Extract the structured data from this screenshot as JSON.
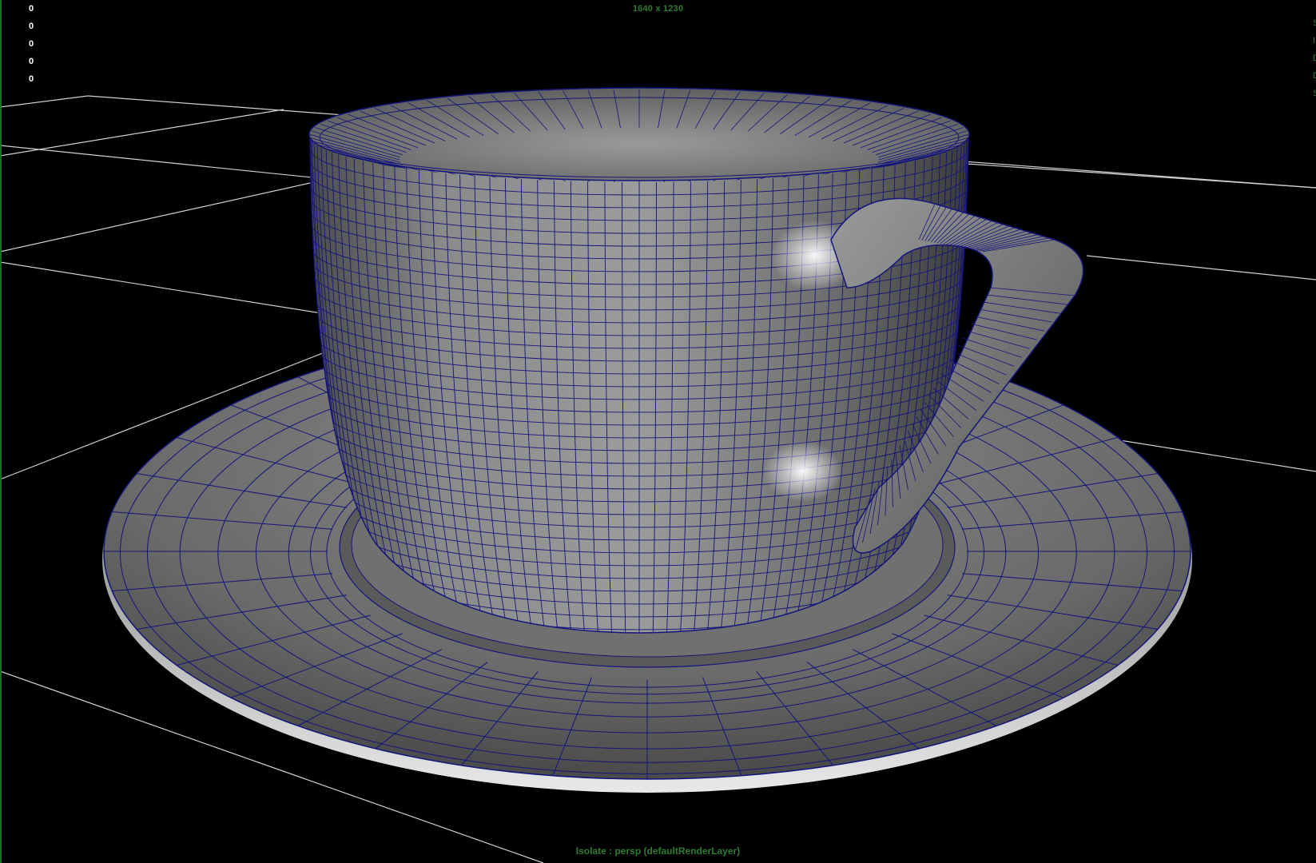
{
  "viewport": {
    "resolution_gate": "1640 x 1230",
    "camera_label": "Isolate : persp (defaultRenderLayer)",
    "hud_counts": [
      "0",
      "0",
      "0",
      "0",
      "0"
    ],
    "hud_right_letters": [
      "S",
      "I",
      "D",
      "D",
      "S"
    ]
  },
  "colors": {
    "background": "#000000",
    "hud_text": "#ffffff",
    "hud_green": "#2e7d32",
    "grid_line": "#cfcfcf",
    "wireframe": "#14147a",
    "shading": "#7a7a7a",
    "edge_bar": "#1f6b1f"
  },
  "scene": {
    "object": "teacup-with-saucer",
    "display_mode": "smooth-shade-with-wireframe"
  }
}
